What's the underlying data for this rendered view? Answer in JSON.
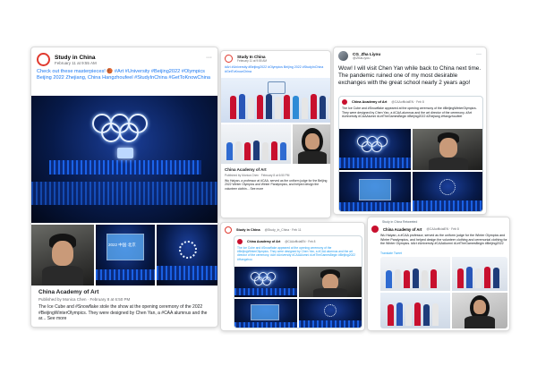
{
  "left_post": {
    "page_name": "Study in China",
    "date": "February 11 at 9:55 AM",
    "body": "Check out these masterpieces! 🏀 #Art #University #Beijing2022 #Olympics Beijing 2022 Zhejiang, China Hangzhoufeel #StudyInChina #GetToKnowChina",
    "shared_name": "China Academy of Art",
    "shared_meta": "Published by Monica Chen · February 8 at 6:50 PM",
    "shared_body": "The Ice Cube and #Snowflake stole the show at the opening ceremony of the 2022 #BeijingWinterOlympics. They were designed by Chen Yan, a #CAA alumnus and the ar... See more",
    "inset_text": "2022 中国·北京"
  },
  "middle_top": {
    "page_name": "Study In China",
    "date": "February 11 at 9:55 AM",
    "body": "#Art #University #Beijing2022 #Olympics Beijing 2022 #StudyInChina #GetToKnowChina",
    "shared_name": "China Academy of Art",
    "shared_meta": "Published by Monica Chen · February 8 at 6:50 PM",
    "shared_body": "Wu Haiyan, a professor at #CAA, served as the uniform judge for the Beijing 2022 Winter Olympics and Winter Paralympics, and helped design the volunteer clothin... See more"
  },
  "middle_bottom": {
    "account": "Study in China",
    "handle": "@Study_In_China · Feb 11",
    "quoted_name": "China Academy of Art",
    "quoted_handle": "@CAAofficialEN · Feb 8",
    "quoted_body": "The Ice Cube and #Snowflake appeared at the opening ceremony of the #BeijingWinterOlympics. They were designed by Chen Yan, a #CAA alumnus and the art director of the ceremony. #Art #University #CAAAlumni #LetTheGamesBegin #Beijing2022 #Hangzhou"
  },
  "right_tweet": {
    "account": "CG_Zha Liyou",
    "handle": "@ZhaLiyou",
    "body": "Wow! I will visit Chen Yan while back to China next time. The pandemic ruined one of my most desirable exchanges with the great school nearly 2 years ago!",
    "quoted_name": "China Academy of Art",
    "quoted_handle": "@CAAofficialEN · Feb 8",
    "quoted_body": "The Ice Cube and #Snowflake appeared at the opening ceremony of the #BeijingWinterOlympics. They were designed by Chen Yan, a #CAA alumnus and the art director of the ceremony. #Art #University #CAAAlumni #LetTheGamesBegin #Beijing2022 #Zhejiang #Hangzhoufeel"
  },
  "right_bottom": {
    "retweet_label": "Study in China Retweeted",
    "account": "China Academy of Art",
    "handle": "@CAAofficialEN · Feb 8",
    "body": "Wu Haiyan, a #CAA professor, served as the uniform judge for the Winter Olympics and Winter Paralympics, and helped design the volunteer clothing and ceremonial clothing for the Winter Olympics. #Art #University #CAAAlumni #LetTheGamesBegin #Beijing2022",
    "translate": "Translate Tweet"
  }
}
